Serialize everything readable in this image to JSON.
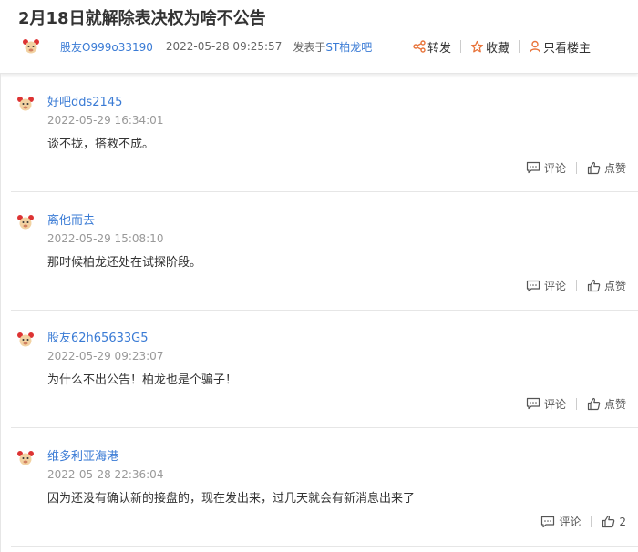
{
  "post": {
    "title": "2月18日就解除表决权为啥不公告",
    "author": "股友O999o33190",
    "time": "2022-05-28 09:25:57",
    "posted_in_prefix": "发表于",
    "bar_name": "ST柏龙吧",
    "share_label": "转发",
    "favorite_label": "收藏",
    "owner_only_label": "只看楼主"
  },
  "comment_label": "评论",
  "like_label": "点赞",
  "colors": {
    "link": "#3a7bd5",
    "text": "#333333",
    "muted": "#999999"
  },
  "icons": [
    "avatar-icon",
    "share-icon",
    "star-icon",
    "person-icon",
    "comment-icon",
    "thumbs-up-icon"
  ],
  "comments": [
    {
      "user": "好吧dds2145",
      "time": "2022-05-29 16:34:01",
      "text": "谈不拢，搭救不成。",
      "like_text": "点赞"
    },
    {
      "user": "离他而去",
      "time": "2022-05-29 15:08:10",
      "text": "那时候柏龙还处在试探阶段。",
      "like_text": "点赞"
    },
    {
      "user": "股友62h65633G5",
      "time": "2022-05-29 09:23:07",
      "text": "为什么不出公告！柏龙也是个骗子！",
      "like_text": "点赞"
    },
    {
      "user": "维多利亚海港",
      "time": "2022-05-28 22:36:04",
      "text": "因为还没有确认新的接盘的，现在发出来，过几天就会有新消息出来了",
      "like_text": "2"
    }
  ]
}
